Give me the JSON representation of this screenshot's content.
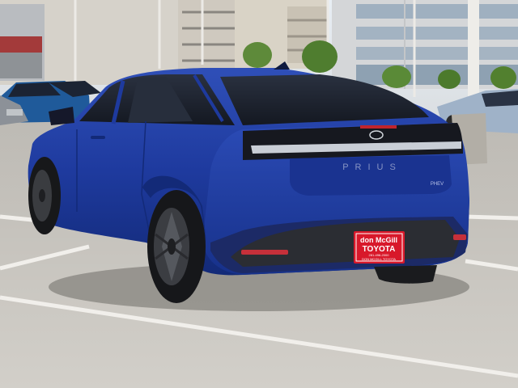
{
  "photo": {
    "subject": "Toyota Prius",
    "colors": {
      "car_body": "#1f3a9c",
      "car_body_dark": "#14256e",
      "car_body_light": "#3a5bc4",
      "glass": "#1a1f2b",
      "pavement": "#c9c6c0",
      "sky": "#dfe6ee",
      "plate": "#d8182a"
    }
  },
  "car": {
    "badge_model": "PRIUS",
    "badge_variant": "PHEV"
  },
  "plate": {
    "line1": "don McGill",
    "line2": "TOYOTA",
    "line3": "281-496-2000",
    "line4": "DON MCGILL TOYOTA"
  }
}
